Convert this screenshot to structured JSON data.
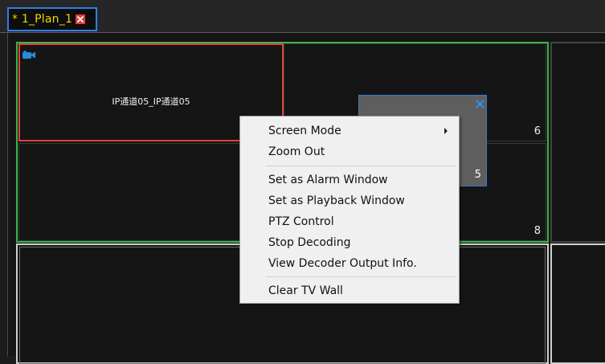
{
  "tab": {
    "label": "* 1_Plan_1",
    "close_icon": "close-icon"
  },
  "wall": {
    "cells": [
      {
        "channel": "IP通道05_IP通道05",
        "number": ""
      },
      {
        "channel": "",
        "number": "6"
      },
      {
        "channel": "",
        "number": ""
      },
      {
        "channel": "",
        "number": "8"
      }
    ],
    "floating_window": {
      "number": "5"
    }
  },
  "context_menu": {
    "items": [
      {
        "label": "Screen Mode",
        "has_submenu": true
      },
      {
        "label": "Zoom Out"
      },
      {
        "label": "Set as Alarm Window"
      },
      {
        "label": "Set as Playback Window"
      },
      {
        "label": "PTZ Control"
      },
      {
        "label": "Stop Decoding"
      },
      {
        "label": "View Decoder Output Info."
      },
      {
        "label": "Clear TV Wall"
      }
    ]
  },
  "colors": {
    "tab_text": "#f2d500",
    "tab_border": "#2f7fe8",
    "screen_active_border": "#39b44a",
    "selected_cell_border": "#e0403a",
    "floating_window_border": "#3a7ad1"
  }
}
